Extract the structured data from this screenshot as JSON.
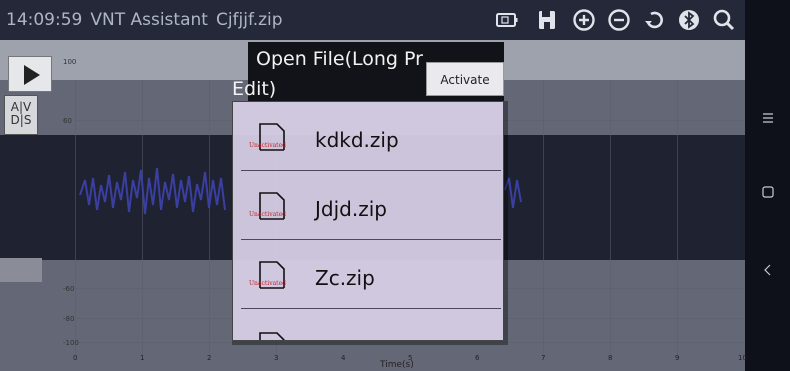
{
  "status_bar": {
    "time": "14:09:59",
    "app_title": "VNT Assistant",
    "file_name": "Cjfjjf.zip",
    "icons": [
      "battery-icon",
      "save-icon",
      "zoom-in-icon",
      "zoom-out-icon",
      "undo-icon",
      "bluetooth-icon",
      "search-icon"
    ]
  },
  "chart": {
    "x_axis_label": "Time(s)",
    "x_ticks": [
      "0",
      "1",
      "2",
      "3",
      "4",
      "5",
      "6",
      "7",
      "8",
      "9",
      "10"
    ],
    "y_ticks": [
      "100",
      "60",
      "-60",
      "-80",
      "-100"
    ],
    "avd_label_top": "A|V",
    "avd_label_bottom": "D|S"
  },
  "dialog": {
    "title": "Open File(Long Press to Edit)",
    "title_line1": "Open File(Long Pr",
    "title_line2": "Edit)",
    "activate_button": "Activate",
    "files": [
      {
        "name": "kdkd.zip",
        "badge": "Unactivated"
      },
      {
        "name": "Jdjd.zip",
        "badge": "Unactivated"
      },
      {
        "name": "Zc.zip",
        "badge": "Unactivated"
      },
      {
        "name": "",
        "badge": ""
      }
    ]
  },
  "nav_bar": {
    "buttons": [
      "menu-icon",
      "home-icon",
      "back-icon"
    ]
  },
  "colors": {
    "status_bar_bg": "#242838",
    "dialog_panel": "#dcd4ec",
    "waveform": "#3a3fa0",
    "unactivated_text": "#c0242a"
  }
}
